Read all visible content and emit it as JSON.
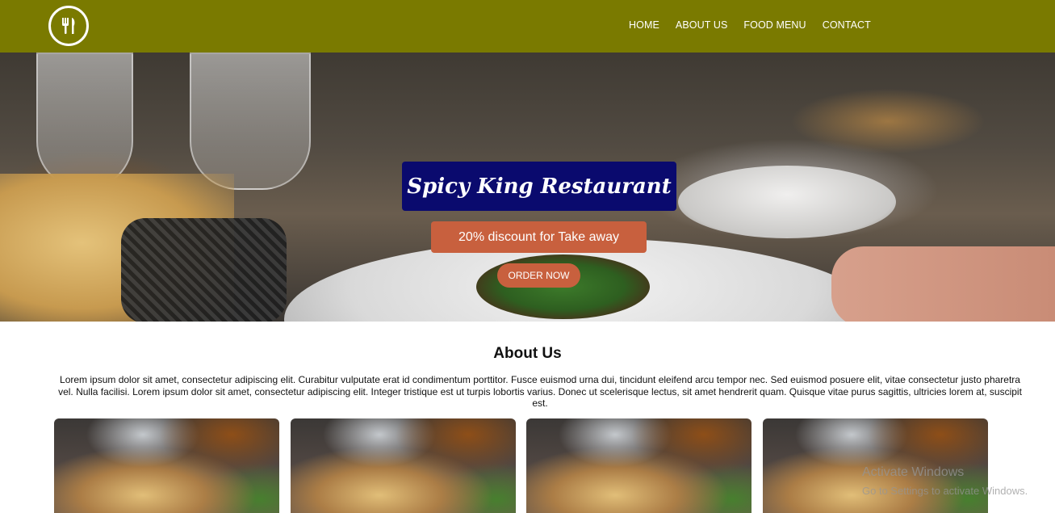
{
  "header": {
    "nav": [
      {
        "label": "HOME"
      },
      {
        "label": "ABOUT US"
      },
      {
        "label": "FOOD MENU"
      },
      {
        "label": "CONTACT"
      }
    ],
    "logo_icon": "fork-knife-icon"
  },
  "hero": {
    "title": "Spicy King Restaurant",
    "discount": "20% discount for Take away",
    "order_button": "ORDER NOW"
  },
  "about": {
    "title": "About Us",
    "text": "Lorem ipsum dolor sit amet, consectetur adipiscing elit. Curabitur vulputate erat id condimentum porttitor. Fusce euismod urna dui, tincidunt eleifend arcu tempor nec. Sed euismod posuere elit, vitae consectetur justo pharetra vel. Nulla facilisi. Lorem ipsum dolor sit amet, consectetur adipiscing elit. Integer tristique est ut turpis lobortis varius. Donec ut scelerisque lectus, sit amet hendrerit quam. Quisque vitae purus sagittis, ultricies lorem at, suscipit est."
  },
  "cards": [
    {
      "image": "food-photo"
    },
    {
      "image": "food-photo"
    },
    {
      "image": "food-photo"
    },
    {
      "image": "food-photo"
    }
  ],
  "windows_watermark": {
    "title": "Activate Windows",
    "subtitle": "Go to Settings to activate Windows."
  },
  "colors": {
    "header_bg": "#7a7a00",
    "title_box_bg": "#0a0a6e",
    "accent": "#c8603e"
  }
}
